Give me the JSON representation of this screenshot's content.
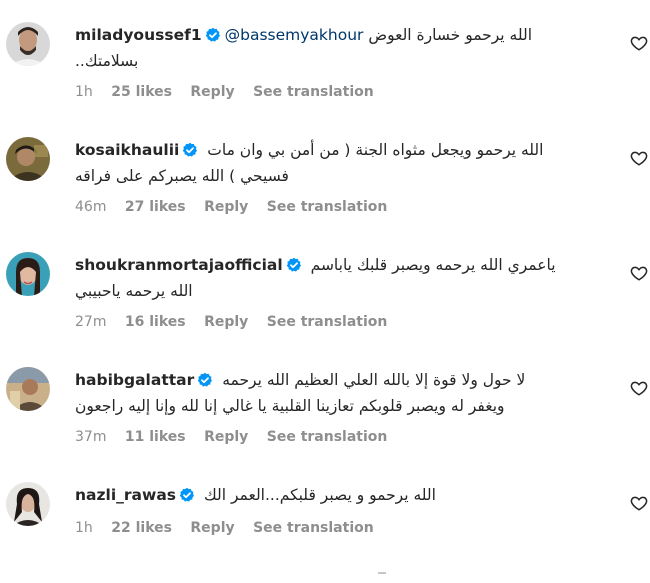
{
  "comments": [
    {
      "username": "miladyoussef1",
      "mention": "@bassemyakhour",
      "line1_text": "الله يرحمو خسارة العوض",
      "line2_text": "بسلامتك..",
      "time": "1h",
      "likes": "25 likes",
      "reply": "Reply",
      "translate": "See translation"
    },
    {
      "username": "kosaikhaulii",
      "mention": "",
      "line1_text": "الله يرحمو ويجعل مثواه الجنة ( من أمن بي وان مات",
      "line2_text": "فسيحي ) الله يصبركم على فراقه",
      "time": "46m",
      "likes": "27 likes",
      "reply": "Reply",
      "translate": "See translation"
    },
    {
      "username": "shoukranmortajaofficial",
      "mention": "",
      "line1_text": "ياعمري الله يرحمه ويصبر قلبك ياباسم",
      "line2_text": "الله يرحمه ياحبيبي",
      "time": "27m",
      "likes": "16 likes",
      "reply": "Reply",
      "translate": "See translation"
    },
    {
      "username": "habibgalattar",
      "mention": "",
      "line1_text": "لا حول ولا قوة إلا بالله العلي العظيم الله يرحمه",
      "line2_text": "ويغفر له ويصبر قلوبكم تعازينا القلبية يا غالي إنا لله وإنا إليه راجعون",
      "time": "37m",
      "likes": "11 likes",
      "reply": "Reply",
      "translate": "See translation"
    },
    {
      "username": "nazli_rawas",
      "mention": "",
      "line1_text": "الله يرحمو و يصبر قلبكم...العمر الك",
      "line2_text": "",
      "time": "1h",
      "likes": "22 likes",
      "reply": "Reply",
      "translate": "See translation"
    }
  ],
  "colors": {
    "verified": "#0095f6",
    "mention": "#00376b",
    "meta": "#8e8e8e",
    "text": "#262626"
  },
  "icons": {
    "verified": "verified-badge-icon",
    "like": "heart-outline-icon"
  }
}
